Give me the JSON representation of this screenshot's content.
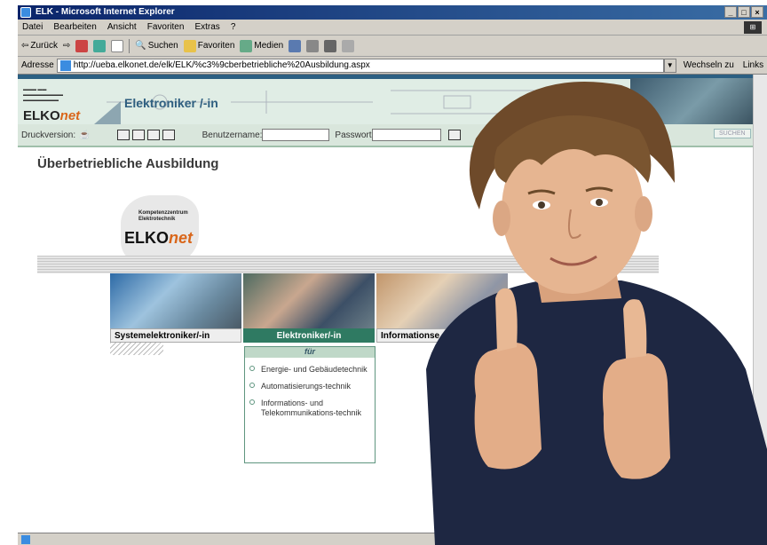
{
  "window": {
    "title": "ELK - Microsoft Internet Explorer",
    "controls": [
      "_",
      "□",
      "×"
    ]
  },
  "menu": {
    "items": [
      "Datei",
      "Bearbeiten",
      "Ansicht",
      "Favoriten",
      "Extras",
      "?"
    ]
  },
  "toolbar": {
    "back_label": "Zurück",
    "search_label": "Suchen",
    "favorites_label": "Favoriten",
    "media_label": "Medien"
  },
  "address": {
    "label": "Adresse",
    "url": "http://ueba.elkonet.de/elk/ELK/%c3%9cberbetriebliche%20Ausbildung.aspx",
    "go_label": "Wechseln zu",
    "links_label": "Links"
  },
  "site": {
    "brand_prefix": "ELKO",
    "brand_suffix": "net",
    "page_heading": "Elektroniker /-in",
    "druck_label": "Druckversion:",
    "user_label": "Benutzername:",
    "password_label": "Passwort",
    "search_button": "SUCHEN",
    "main_title": "Überbetriebliche Ausbildung",
    "logo_line1": "Kompetenzzentrum",
    "logo_line2": "Elektrotechnik",
    "cards": [
      {
        "label": "Systemelektroniker/-in"
      },
      {
        "label": "Elektroniker/-in"
      },
      {
        "label": "Informationse"
      }
    ],
    "dropdown": {
      "heading": "für",
      "items": [
        "Energie- und Gebäudetechnik",
        "Automatisierungs-technik",
        "Informations- und Telekommunikations-technik"
      ]
    }
  }
}
